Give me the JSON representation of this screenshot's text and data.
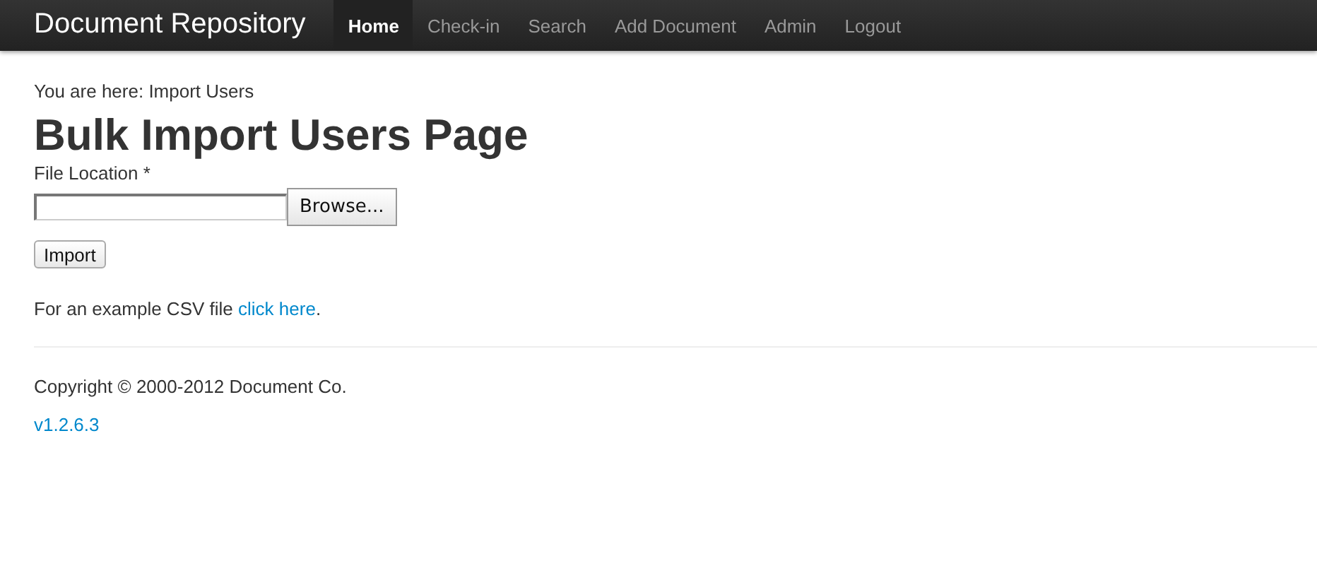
{
  "navbar": {
    "brand": "Document Repository",
    "items": [
      {
        "label": "Home",
        "selected": true
      },
      {
        "label": "Check-in",
        "selected": false
      },
      {
        "label": "Search",
        "selected": false
      },
      {
        "label": "Add Document",
        "selected": false
      },
      {
        "label": "Admin",
        "selected": false
      },
      {
        "label": "Logout",
        "selected": false
      }
    ]
  },
  "breadcrumb": "You are here: Import Users",
  "heading": "Bulk Import Users Page",
  "form": {
    "label": "File Location *",
    "browse_button": "Browse...",
    "import_button": "Import"
  },
  "example": {
    "text": "For an example CSV file ",
    "link": "click here",
    "after": "."
  },
  "footer": {
    "copyright": "Copyright © 2000-2012 Document Co.",
    "version": "v1.2.6.3"
  }
}
